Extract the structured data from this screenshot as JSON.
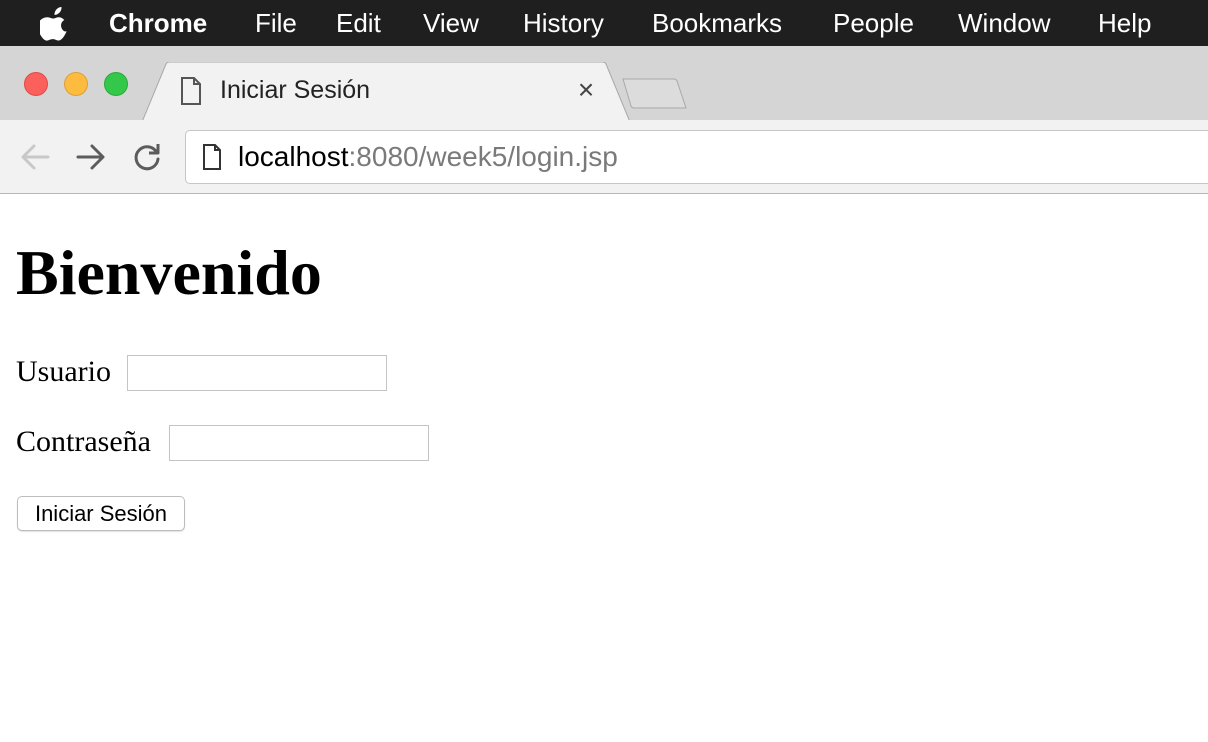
{
  "menubar": {
    "app_name": "Chrome",
    "items": [
      "File",
      "Edit",
      "View",
      "History",
      "Bookmarks",
      "People",
      "Window",
      "Help"
    ]
  },
  "tab": {
    "title": "Iniciar Sesión",
    "close_glyph": "×"
  },
  "address_bar": {
    "host": "localhost",
    "rest": ":8080/week5/login.jsp"
  },
  "page": {
    "heading": "Bienvenido",
    "username_label": "Usuario",
    "username_value": "",
    "password_label": "Contraseña",
    "password_value": "",
    "submit_label": "Iniciar Sesión"
  },
  "icons": {
    "apple": "apple-logo-icon",
    "tab_page": "document-icon",
    "back": "back-arrow-icon",
    "forward": "forward-arrow-icon",
    "reload": "reload-icon",
    "omnibox_page": "document-icon"
  },
  "colors": {
    "menubar_bg": "#1f1f1f",
    "tabstrip_bg": "#d5d5d5",
    "toolbar_bg": "#f2f2f2",
    "traffic_close": "#fc605c",
    "traffic_minimize": "#fdbc40",
    "traffic_maximize": "#34c84a",
    "url_path": "#7a7a7a"
  }
}
